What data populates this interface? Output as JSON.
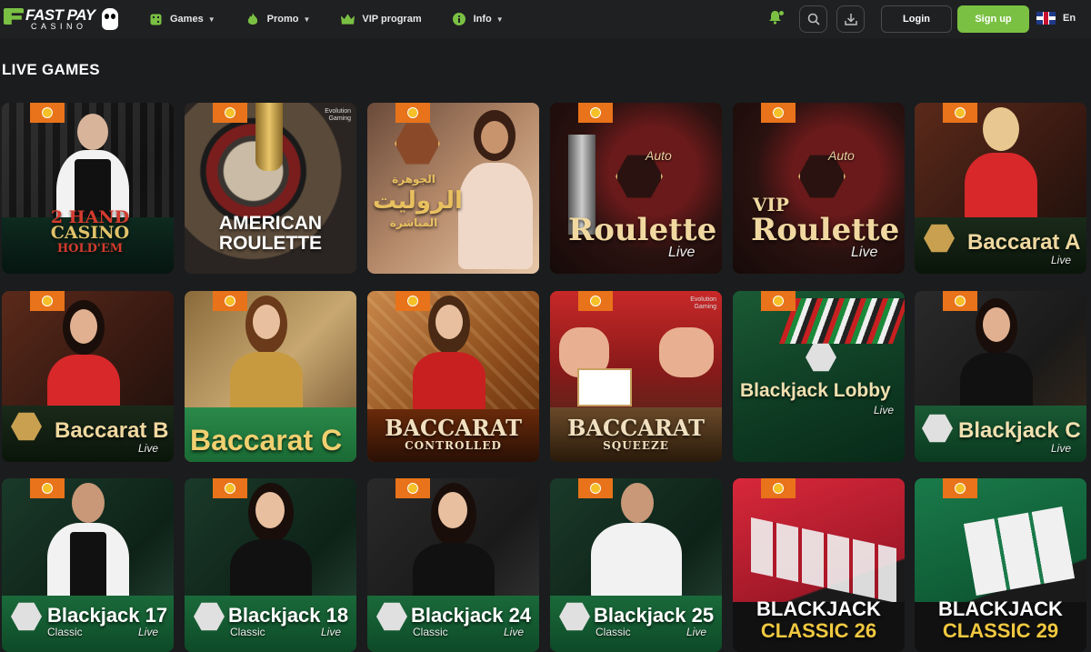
{
  "header": {
    "logo_text": "FAST PAY",
    "logo_sub": "CASINO",
    "nav": [
      {
        "label": "Games",
        "icon": "dice-icon",
        "caret": true
      },
      {
        "label": "Promo",
        "icon": "flame-icon",
        "caret": true
      },
      {
        "label": "VIP program",
        "icon": "crown-icon",
        "caret": false
      },
      {
        "label": "Info",
        "icon": "info-icon",
        "caret": true
      }
    ],
    "login_label": "Login",
    "signup_label": "Sign up",
    "language": "En"
  },
  "colors": {
    "accent": "#7ac143",
    "badge": "#e8731a",
    "background": "#1b1c1e"
  },
  "section_title": "LIVE GAMES",
  "games": [
    {
      "title": "2 HAND CASINO HOLD'EM",
      "title_lines": [
        "2 HAND",
        "CASINO",
        "HOLD'EM"
      ],
      "subtitle": ""
    },
    {
      "title": "AMERICAN ROULETTE",
      "title_lines": [
        "AMERICAN",
        "ROULETTE"
      ],
      "subtitle": ""
    },
    {
      "title": "الروليت المباشرة",
      "title_lines": [
        "الجوهرة",
        "الروليت",
        "المباشرة"
      ],
      "subtitle": ""
    },
    {
      "title": "Roulette",
      "title_lines": [
        "Roulette"
      ],
      "subtitle": "Live",
      "tag": "Auto"
    },
    {
      "title": "VIP Roulette",
      "title_lines": [
        "VIP",
        "Roulette"
      ],
      "subtitle": "Live",
      "tag": "Auto"
    },
    {
      "title": "Baccarat A",
      "title_lines": [
        "Baccarat A"
      ],
      "subtitle": "Live"
    },
    {
      "title": "Baccarat B",
      "title_lines": [
        "Baccarat B"
      ],
      "subtitle": "Live"
    },
    {
      "title": "Baccarat C",
      "title_lines": [
        "Baccarat C"
      ],
      "subtitle": ""
    },
    {
      "title": "BACCARAT CONTROLLED",
      "title_lines": [
        "BACCARAT",
        "CONTROLLED"
      ],
      "subtitle": ""
    },
    {
      "title": "BACCARAT SQUEEZE",
      "title_lines": [
        "BACCARAT",
        "SQUEEZE"
      ],
      "subtitle": ""
    },
    {
      "title": "Blackjack Lobby",
      "title_lines": [
        "Blackjack Lobby"
      ],
      "subtitle": "Live"
    },
    {
      "title": "Blackjack C",
      "title_lines": [
        "Blackjack C"
      ],
      "subtitle": "Live"
    },
    {
      "title": "Blackjack 17",
      "title_lines": [
        "Blackjack 17"
      ],
      "subtitle": "Live",
      "label": "Classic"
    },
    {
      "title": "Blackjack 18",
      "title_lines": [
        "Blackjack 18"
      ],
      "subtitle": "Live",
      "label": "Classic"
    },
    {
      "title": "Blackjack 24",
      "title_lines": [
        "Blackjack 24"
      ],
      "subtitle": "Live",
      "label": "Classic"
    },
    {
      "title": "Blackjack 25",
      "title_lines": [
        "Blackjack 25"
      ],
      "subtitle": "Live",
      "label": "Classic"
    },
    {
      "title": "BLACKJACK CLASSIC 26",
      "title_lines": [
        "BLACKJACK",
        "CLASSIC 26"
      ],
      "subtitle": ""
    },
    {
      "title": "BLACKJACK CLASSIC 29",
      "title_lines": [
        "BLACKJACK",
        "CLASSIC 29"
      ],
      "subtitle": ""
    }
  ],
  "provider_mark": [
    "Evolution",
    "Gaming"
  ]
}
